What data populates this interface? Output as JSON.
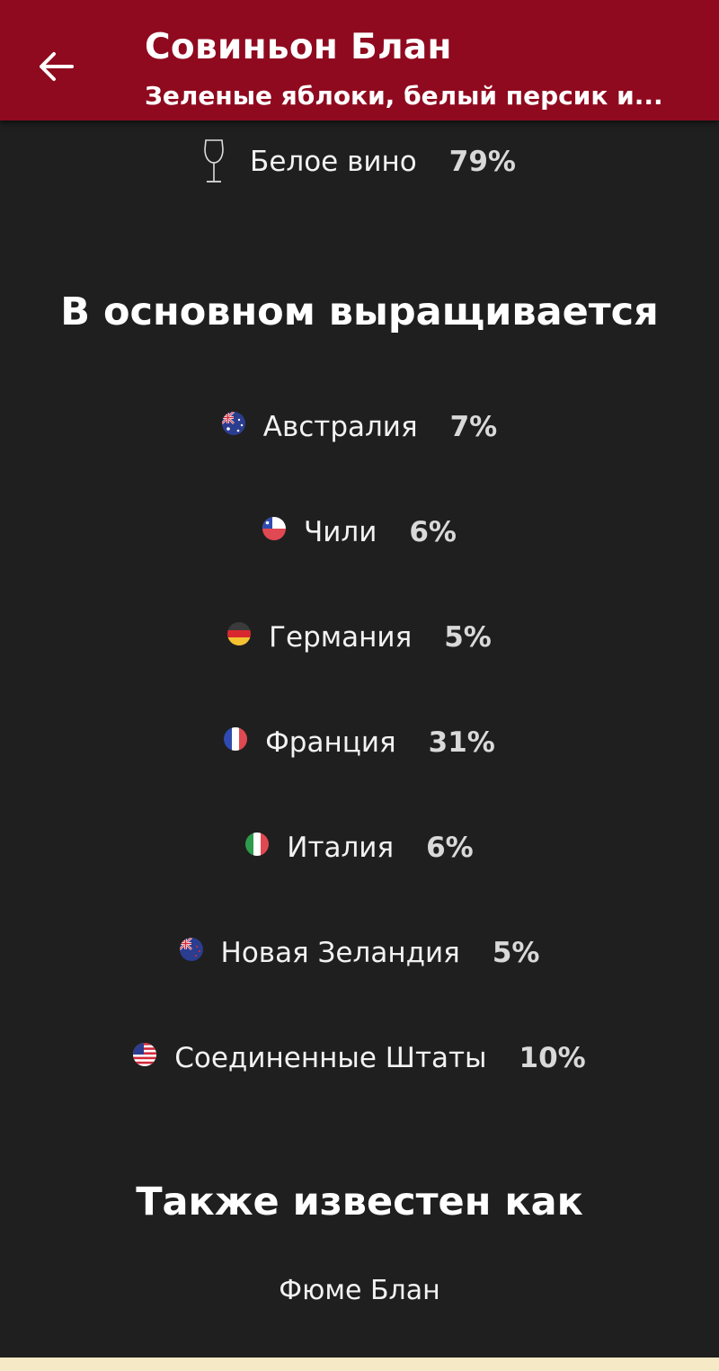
{
  "header": {
    "title": "Совиньон Блан",
    "subtitle": "Зеленые яблоки, белый персик и..."
  },
  "wine_type": {
    "icon": "wine-glass-icon",
    "label": "Белое вино",
    "percent": "79%"
  },
  "grown_section": {
    "title": "В основном выращивается",
    "countries": [
      {
        "name": "Австралия",
        "percent": "7%",
        "icon": "australia-flag-icon"
      },
      {
        "name": "Чили",
        "percent": "6%",
        "icon": "chile-flag-icon"
      },
      {
        "name": "Германия",
        "percent": "5%",
        "icon": "germany-flag-icon"
      },
      {
        "name": "Франция",
        "percent": "31%",
        "icon": "france-flag-icon"
      },
      {
        "name": "Италия",
        "percent": "6%",
        "icon": "italy-flag-icon"
      },
      {
        "name": "Новая Зеландия",
        "percent": "5%",
        "icon": "new-zealand-flag-icon"
      },
      {
        "name": "Соединенные Штаты",
        "percent": "10%",
        "icon": "usa-flag-icon"
      }
    ]
  },
  "aka_section": {
    "title": "Также известен как",
    "synonyms": [
      "Фюме Блан"
    ]
  },
  "colors": {
    "header_background": "#8f0a1f",
    "page_background": "#1f1f1f"
  }
}
